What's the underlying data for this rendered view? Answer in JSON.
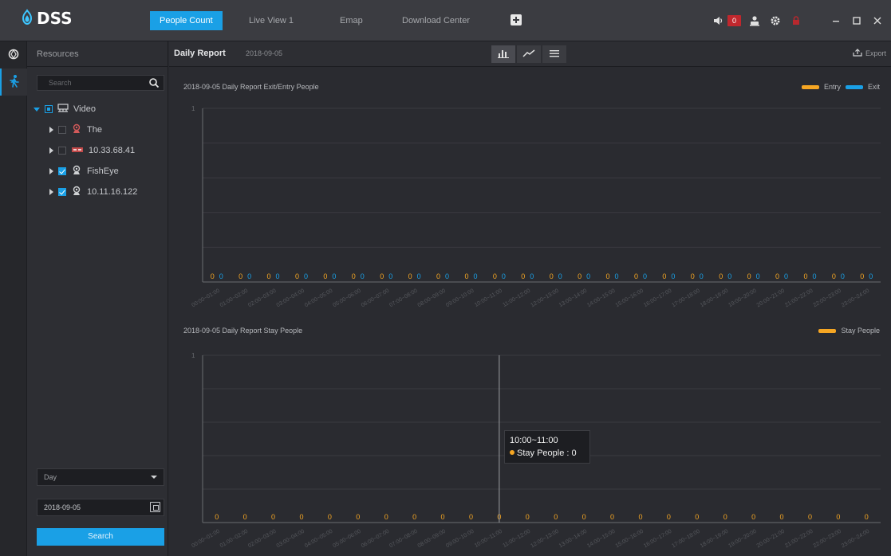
{
  "app": {
    "logo_text": "DSS",
    "tabs": [
      {
        "label": "People Count",
        "active": true
      },
      {
        "label": "Live View 1",
        "active": false
      },
      {
        "label": "Emap",
        "active": false
      },
      {
        "label": "Download Center",
        "active": false
      }
    ],
    "alarm_count": "0"
  },
  "sidebar": {
    "header": "Resources",
    "search_placeholder": "Search",
    "tree": [
      {
        "label": "Video",
        "level": 0,
        "expanded": true,
        "check": "partial",
        "icon": "device-group-icon"
      },
      {
        "label": "The",
        "level": 1,
        "expanded": false,
        "check": "off",
        "icon": "person-camera-icon"
      },
      {
        "label": "10.33.68.41",
        "level": 1,
        "expanded": false,
        "check": "off",
        "icon": "nvr-icon"
      },
      {
        "label": "FishEye",
        "level": 1,
        "expanded": false,
        "check": "on",
        "icon": "person-camera-icon"
      },
      {
        "label": "10.11.16.122",
        "level": 1,
        "expanded": false,
        "check": "on",
        "icon": "person-camera-icon"
      }
    ],
    "period": "Day",
    "date": "2018-09-05",
    "search_button": "Search"
  },
  "report": {
    "title": "Daily Report",
    "date": "2018-09-05",
    "export_label": "Export"
  },
  "tooltip": {
    "time": "10:00~11:00",
    "label": "Stay People",
    "value": 0
  },
  "colors": {
    "entry": "#f5a623",
    "exit": "#1aa0e6",
    "stay": "#f5a623",
    "accent": "#1aa0e6"
  },
  "chart_data": [
    {
      "type": "bar",
      "title": "2018-09-05 Daily Report Exit/Entry People",
      "categories": [
        "00:00~01:00",
        "01:00~02:00",
        "02:00~03:00",
        "03:00~04:00",
        "04:00~05:00",
        "05:00~06:00",
        "06:00~07:00",
        "07:00~08:00",
        "08:00~09:00",
        "09:00~10:00",
        "10:00~11:00",
        "11:00~12:00",
        "12:00~13:00",
        "13:00~14:00",
        "14:00~15:00",
        "15:00~16:00",
        "16:00~17:00",
        "17:00~18:00",
        "18:00~19:00",
        "19:00~20:00",
        "20:00~21:00",
        "21:00~22:00",
        "22:00~23:00",
        "23:00~24:00"
      ],
      "series": [
        {
          "name": "Entry",
          "values": [
            0,
            0,
            0,
            0,
            0,
            0,
            0,
            0,
            0,
            0,
            0,
            0,
            0,
            0,
            0,
            0,
            0,
            0,
            0,
            0,
            0,
            0,
            0,
            0
          ]
        },
        {
          "name": "Exit",
          "values": [
            0,
            0,
            0,
            0,
            0,
            0,
            0,
            0,
            0,
            0,
            0,
            0,
            0,
            0,
            0,
            0,
            0,
            0,
            0,
            0,
            0,
            0,
            0,
            0
          ]
        }
      ],
      "yticks": [
        "1"
      ],
      "ylim": [
        0,
        1
      ],
      "grid": true,
      "legend": "top-right"
    },
    {
      "type": "bar",
      "title": "2018-09-05 Daily Report Stay People",
      "categories": [
        "00:00~01:00",
        "01:00~02:00",
        "02:00~03:00",
        "03:00~04:00",
        "04:00~05:00",
        "05:00~06:00",
        "06:00~07:00",
        "07:00~08:00",
        "08:00~09:00",
        "09:00~10:00",
        "10:00~11:00",
        "11:00~12:00",
        "12:00~13:00",
        "13:00~14:00",
        "14:00~15:00",
        "15:00~16:00",
        "16:00~17:00",
        "17:00~18:00",
        "18:00~19:00",
        "19:00~20:00",
        "20:00~21:00",
        "21:00~22:00",
        "22:00~23:00",
        "23:00~24:00"
      ],
      "series": [
        {
          "name": "Stay People",
          "values": [
            0,
            0,
            0,
            0,
            0,
            0,
            0,
            0,
            0,
            0,
            0,
            0,
            0,
            0,
            0,
            0,
            0,
            0,
            0,
            0,
            0,
            0,
            0,
            0
          ]
        }
      ],
      "yticks": [
        "1"
      ],
      "ylim": [
        0,
        1
      ],
      "grid": true,
      "legend": "top-right"
    }
  ]
}
